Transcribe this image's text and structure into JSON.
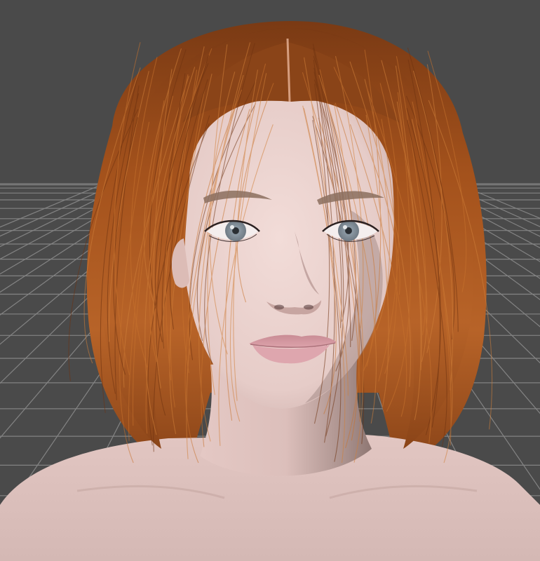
{
  "viewport": {
    "background_color": "#4a4a4a",
    "grid_color": "#8e8e8e",
    "grid_visible": true
  },
  "figure": {
    "hair_color": "#a4521c",
    "hair_highlight_color": "#c8732e",
    "skin_color": "#ead2cf",
    "skin_shadow_color": "#b99a96",
    "lip_color": "#d79aa3",
    "iris_color": "#9aa7b2",
    "brow_color": "#8b6f5e"
  }
}
